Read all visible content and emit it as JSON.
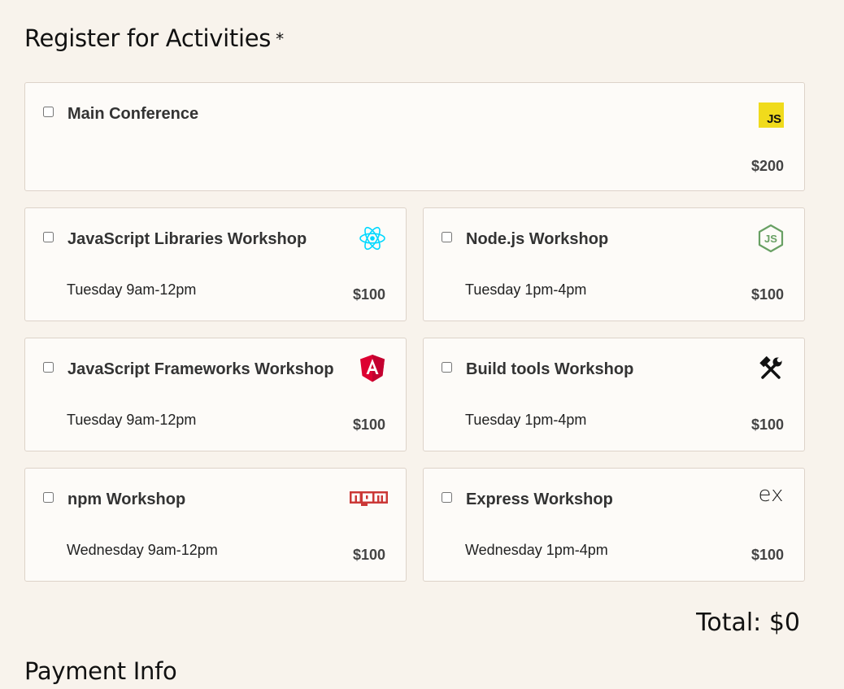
{
  "activities": {
    "title": "Register for Activities",
    "required_marker": "*",
    "main": {
      "name": "Main Conference",
      "price": "$200",
      "icon": "javascript-logo-icon",
      "icon_text": "JS",
      "checked": false
    },
    "workshops": [
      {
        "name": "JavaScript Libraries Workshop",
        "time": "Tuesday 9am-12pm",
        "price": "$100",
        "icon": "react-logo-icon",
        "checked": false
      },
      {
        "name": "Node.js Workshop",
        "time": "Tuesday 1pm-4pm",
        "price": "$100",
        "icon": "nodejs-logo-icon",
        "checked": false
      },
      {
        "name": "JavaScript Frameworks Workshop",
        "time": "Tuesday 9am-12pm",
        "price": "$100",
        "icon": "angular-logo-icon",
        "checked": false
      },
      {
        "name": "Build tools Workshop",
        "time": "Tuesday 1pm-4pm",
        "price": "$100",
        "icon": "tools-icon",
        "checked": false
      },
      {
        "name": "npm Workshop",
        "time": "Wednesday 9am-12pm",
        "price": "$100",
        "icon": "npm-logo-icon",
        "checked": false
      },
      {
        "name": "Express Workshop",
        "time": "Wednesday 1pm-4pm",
        "price": "$100",
        "icon": "express-logo-icon",
        "checked": false
      }
    ]
  },
  "total": {
    "label": "Total: $0"
  },
  "payment": {
    "title": "Payment Info"
  },
  "colors": {
    "background": "#f8f3ec",
    "card": "#fdfbf8",
    "js_yellow": "#f0db1c",
    "react": "#00d8ff",
    "node": "#68a063",
    "angular": "#dd0031",
    "npm": "#cb3837"
  }
}
